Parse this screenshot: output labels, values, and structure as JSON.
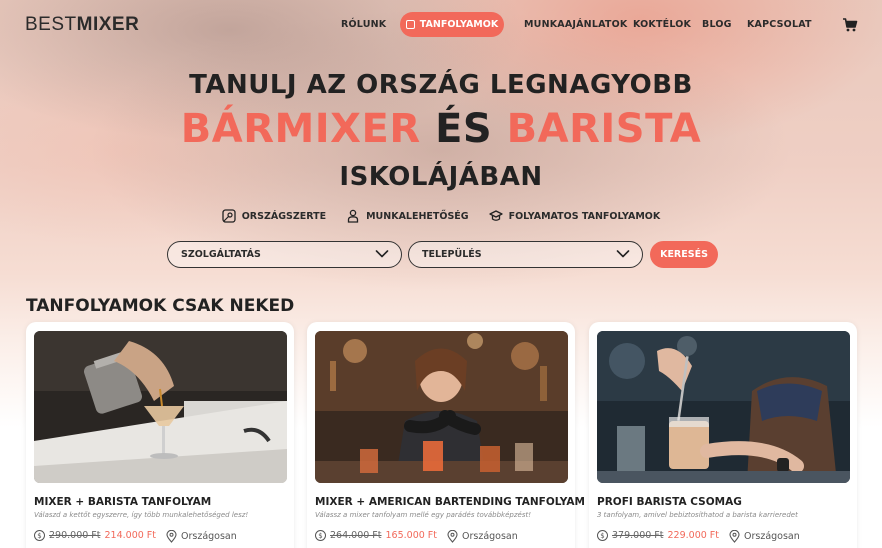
{
  "brand": {
    "logo_thin": "BEST",
    "logo_bold": "MIXER"
  },
  "nav": {
    "items": [
      "RÓLUNK",
      "TANFOLYAMOK",
      "MUNKAAJÁNLATOK",
      "KOKTÉLOK",
      "BLOG",
      "KAPCSOLAT"
    ],
    "active": "TANFOLYAMOK"
  },
  "hero": {
    "line1": "TANULJ AZ  ORSZÁG LEGNAGYOBB",
    "line2_accent1": "BÁRMIXER",
    "line2_middle": "ÉS",
    "line2_accent2": "BARISTA",
    "line3": "ISKOLÁJÁBAN",
    "features": [
      "ORSZÁGSZERTE",
      "MUNKALEHETŐSÉG",
      "FOLYAMATOS TANFOLYAMOK"
    ]
  },
  "search": {
    "service_select": "SZOLGÁLTATÁS",
    "city_select": "TELEPÜLÉS",
    "button": "KERESÉS"
  },
  "section_title": "TANFOLYAMOK CSAK NEKED",
  "cards": [
    {
      "title": "MIXER + BARISTA TANFOLYAM",
      "subtitle": "Válaszd a kettőt egyszerre, így több munkalehetőséged lesz!",
      "old_price": "290.000 Ft",
      "new_price": "214.000 Ft",
      "location": "Országosan"
    },
    {
      "title": "MIXER + AMERICAN BARTENDING TANFOLYAM",
      "subtitle": "Válassz a mixer tanfolyam mellé egy parádés továbbképzést!",
      "old_price": "264.000 Ft",
      "new_price": "165.000 Ft",
      "location": "Országosan"
    },
    {
      "title": "PROFI BARISTA CSOMAG",
      "subtitle": "3 tanfolyam, amivel bebiztosíthatod a barista karrieredet",
      "old_price": "379.000 Ft",
      "new_price": "229.000 Ft",
      "location": "Országosan"
    }
  ],
  "colors": {
    "accent": "#f2695a",
    "dark": "#222222"
  }
}
